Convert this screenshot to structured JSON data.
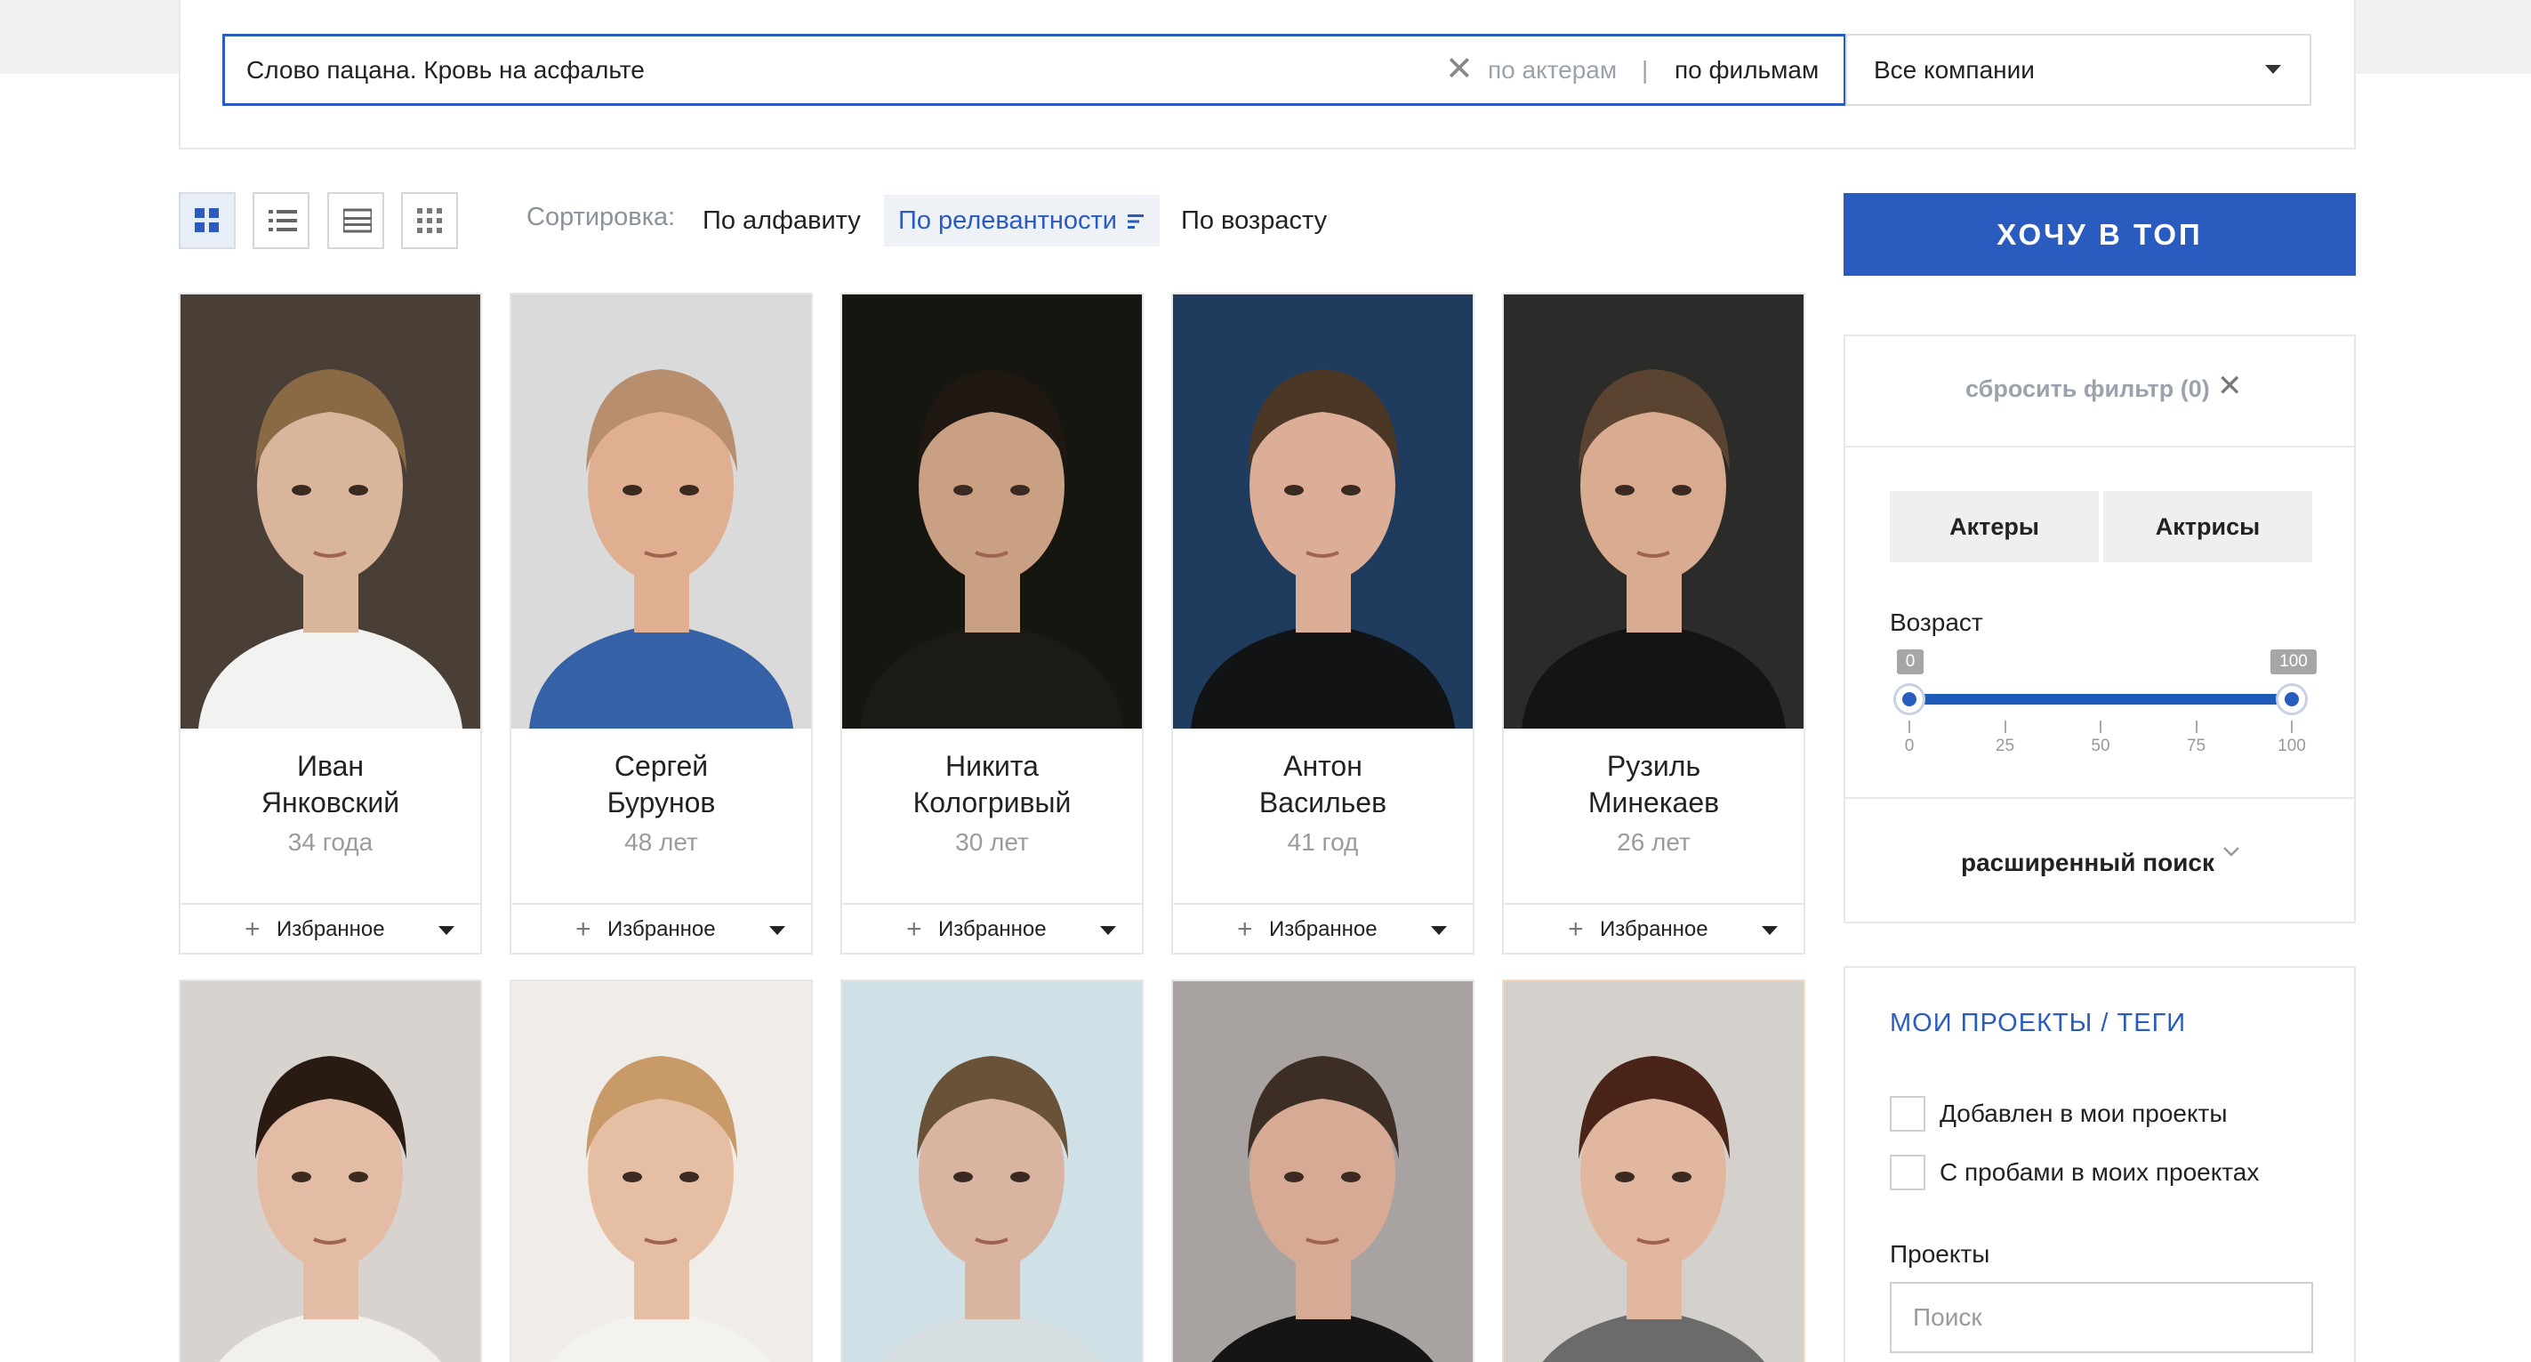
{
  "search": {
    "query": "Слово пацана. Кровь на асфальте",
    "mode_actors": "по актерам",
    "mode_separator": "|",
    "mode_films": "по фильмам",
    "company_select": "Все компании"
  },
  "toolbar": {
    "sort_label": "Сортировка:",
    "sort_options": [
      "По алфавиту",
      "По релевантности",
      "По возрасту"
    ],
    "active_sort": "По релевантности",
    "views": [
      "grid-large",
      "list",
      "list-detailed",
      "grid-small"
    ],
    "active_view": "grid-large"
  },
  "top_button": {
    "label": "ХОЧУ В ТОП"
  },
  "actors": [
    {
      "first": "Иван",
      "last": "Янковский",
      "age": "34 года",
      "fav": "Избранное",
      "photo_bg": "#4a3f36",
      "skin": "#d9b59c",
      "hair": "#8a6a45",
      "shirt": "#f2f2f0"
    },
    {
      "first": "Сергей",
      "last": "Бурунов",
      "age": "48 лет",
      "fav": "Избранное",
      "photo_bg": "#d9dad9",
      "skin": "#e0ae90",
      "hair": "#b78f6e",
      "shirt": "#3562a6"
    },
    {
      "first": "Никита",
      "last": "Кологривый",
      "age": "30 лет",
      "fav": "Избранное",
      "photo_bg": "#14160f",
      "skin": "#caa084",
      "hair": "#1e1712",
      "shirt": "#1b1a17"
    },
    {
      "first": "Антон",
      "last": "Васильев",
      "age": "41 год",
      "fav": "Избранное",
      "photo_bg": "#1f3b5e",
      "skin": "#dcae97",
      "hair": "#4a3725",
      "shirt": "#111314"
    },
    {
      "first": "Рузиль",
      "last": "Минекаев",
      "age": "26 лет",
      "fav": "Избранное",
      "photo_bg": "#2b2b2a",
      "skin": "#d9ab91",
      "hair": "#5a4330",
      "shirt": "#141414"
    },
    {
      "photo_bg": "#d8d3cf",
      "skin": "#e4bba5",
      "hair": "#2a1b12",
      "shirt": "#f2f0ed"
    },
    {
      "photo_bg": "#f0ede8",
      "skin": "#e6bea3",
      "hair": "#c79a68",
      "shirt": "#f4f2ef"
    },
    {
      "photo_bg": "#cfe1e6",
      "skin": "#d9b4a1",
      "hair": "#6a5239",
      "shirt": "#d6dde0"
    },
    {
      "photo_bg": "#a8a3a0",
      "skin": "#d6aa95",
      "hair": "#3c2e25",
      "shirt": "#151515"
    },
    {
      "photo_bg": "#d4d1cc",
      "skin": "#e1b79f",
      "hair": "#4a2418",
      "shirt": "#6b6b6b"
    }
  ],
  "filter": {
    "reset": "сбросить фильтр (0)",
    "gender": [
      "Актеры",
      "Актрисы"
    ],
    "age_label": "Возраст",
    "age_range": {
      "min": 0,
      "max": 100,
      "low": 0,
      "high": 100
    },
    "age_min_tag": "0",
    "age_max_tag": "100",
    "ticks": [
      "0",
      "25",
      "50",
      "75",
      "100"
    ],
    "advanced": "расширенный поиск"
  },
  "projects": {
    "title": "МОИ ПРОЕКТЫ / ТЕГИ",
    "checks": [
      "Добавлен в мои проекты",
      "С пробами в моих проектах"
    ],
    "projects_label": "Проекты",
    "search_placeholder": "Поиск"
  },
  "colors": {
    "accent": "#2a5bbf",
    "muted": "#9aa3ad"
  }
}
